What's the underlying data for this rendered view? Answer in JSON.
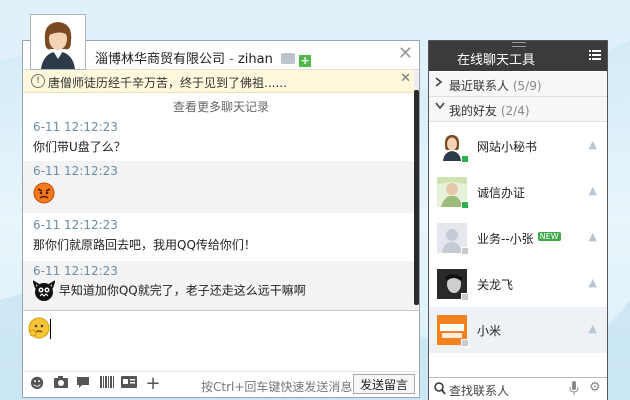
{
  "chat": {
    "title_company": "淄博林华商贸有限公司",
    "title_sep": " - ",
    "title_user": "zihan",
    "close_symbol": "✕",
    "notice_text": "唐僧师徒历经千辛万苦，终于见到了佛祖......",
    "notice_close": "✕",
    "more_history": "查看更多聊天记录",
    "messages": [
      {
        "time": "6-11 12:12:23",
        "text": "你们带U盘了么？",
        "emoji": ""
      },
      {
        "time": "6-11 12:12:23",
        "text": "",
        "emoji": "angry-face"
      },
      {
        "time": "6-11 12:12:23",
        "text": "那你们就原路回去吧，我用QQ传给你们！",
        "emoji": ""
      },
      {
        "time": "6-11 12:12:23",
        "text": "早知道加你QQ就完了，老子还走这么远干嘛啊",
        "emoji": "black-monster-face"
      }
    ],
    "hint": "按Ctrl+回车键快速发送消息",
    "send_label": "发送留言"
  },
  "panel": {
    "title": "在线聊天工具",
    "group_recent": {
      "label": "最近联系人",
      "count": "(5/9)",
      "arrow": "›"
    },
    "group_friends": {
      "label": "我的好友",
      "count": "(2/4)",
      "arrow": "⌄"
    },
    "contacts": [
      {
        "name": "网站小秘书",
        "status": "online",
        "new": ""
      },
      {
        "name": "诚信办证",
        "status": "online",
        "new": ""
      },
      {
        "name": "业务--小张",
        "status": "offline",
        "new": "NEW"
      },
      {
        "name": "关龙飞",
        "status": "offline",
        "new": ""
      },
      {
        "name": "小米",
        "status": "offline",
        "new": ""
      }
    ],
    "search_placeholder": "查找联系人"
  },
  "colors": {
    "online": "#2bb24c",
    "offline": "#c9c9c9",
    "panel_head": "#3b3b3b",
    "time": "#6a8fa8"
  }
}
